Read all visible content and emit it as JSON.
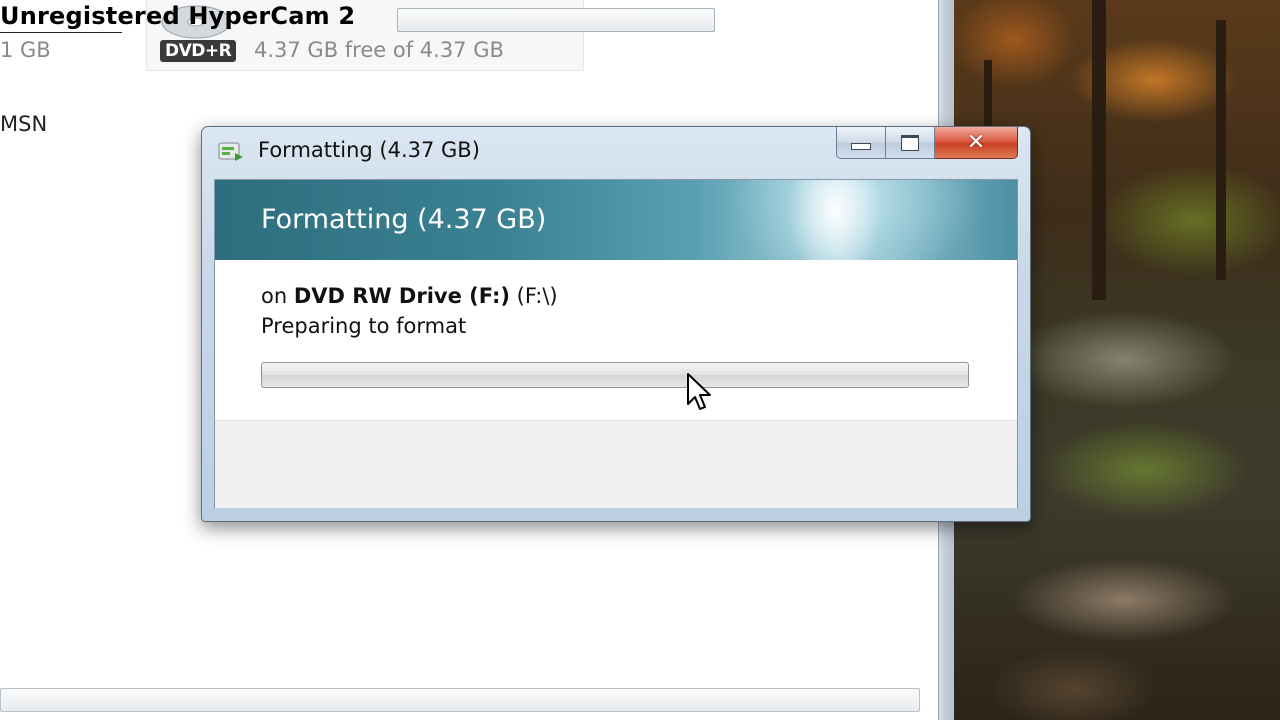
{
  "watermark": "Unregistered HyperCam 2",
  "explorer": {
    "left_size_text": "1 GB",
    "drive_badge": "DVD+R",
    "drive_free_text": "4.37 GB free of 4.37 GB",
    "msn_label": "MSN"
  },
  "dialog": {
    "title": "Formatting (4.37 GB)",
    "banner_title": "Formatting (4.37 GB)",
    "on_prefix": "on",
    "drive_name": "DVD RW Drive (F:)",
    "drive_path": "(F:\\)",
    "status": "Preparing to format",
    "progress": 0,
    "controls": {
      "minimize": "minimize",
      "maximize": "maximize",
      "close": "close"
    }
  }
}
